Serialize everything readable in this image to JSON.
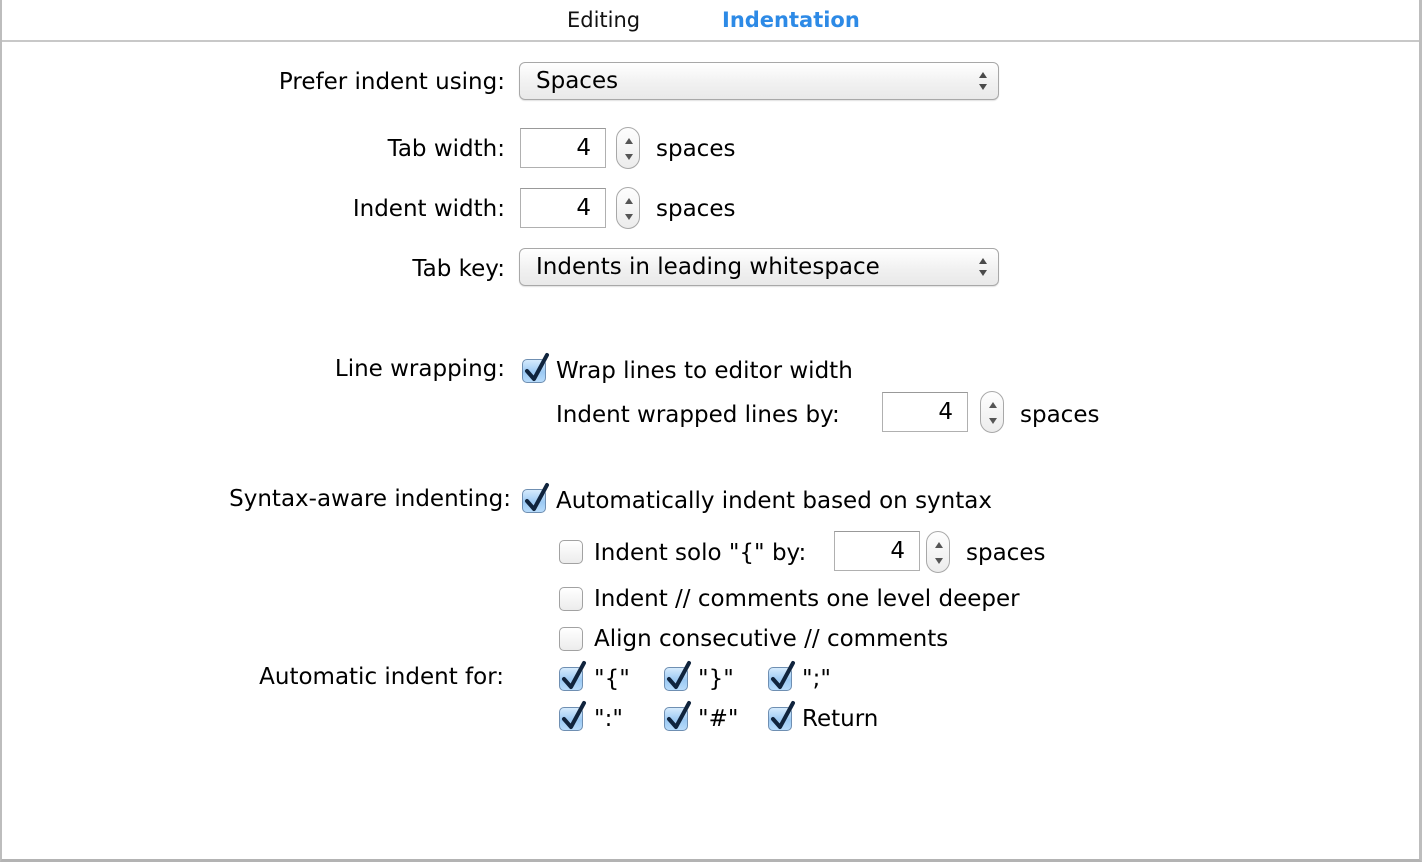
{
  "tabs": [
    {
      "label": "Editing",
      "active": false
    },
    {
      "label": "Indentation",
      "active": true
    }
  ],
  "colors": {
    "active_tab": "#2d8ae6",
    "checkbox_fill": "#9cc9f3",
    "checkmark": "#10243d"
  },
  "prefer_indent": {
    "label": "Prefer indent using:",
    "value": "Spaces"
  },
  "tab_width": {
    "label": "Tab width:",
    "value": "4",
    "unit": "spaces"
  },
  "indent_width": {
    "label": "Indent width:",
    "value": "4",
    "unit": "spaces"
  },
  "tab_key": {
    "label": "Tab key:",
    "value": "Indents in leading whitespace"
  },
  "line_wrapping": {
    "label": "Line wrapping:",
    "wrap_checkbox": {
      "label": "Wrap lines to editor width",
      "checked": true
    },
    "indent_wrapped": {
      "label": "Indent wrapped lines by:",
      "value": "4",
      "unit": "spaces"
    }
  },
  "syntax_aware": {
    "label": "Syntax-aware indenting:",
    "auto_indent": {
      "label": "Automatically indent based on syntax",
      "checked": true
    },
    "indent_solo": {
      "label": "Indent solo \"{\" by:",
      "checked": false,
      "value": "4",
      "unit": "spaces"
    },
    "indent_comments": {
      "label": "Indent // comments one level deeper",
      "checked": false
    },
    "align_comments": {
      "label": "Align consecutive // comments",
      "checked": false
    }
  },
  "automatic_indent": {
    "label": "Automatic indent for:",
    "items": [
      {
        "label": "\"{\"",
        "checked": true
      },
      {
        "label": "\"}\"",
        "checked": true
      },
      {
        "label": "\";\"",
        "checked": true
      },
      {
        "label": "\":\"",
        "checked": true
      },
      {
        "label": "\"#\"",
        "checked": true
      },
      {
        "label": "Return",
        "checked": true
      }
    ]
  }
}
